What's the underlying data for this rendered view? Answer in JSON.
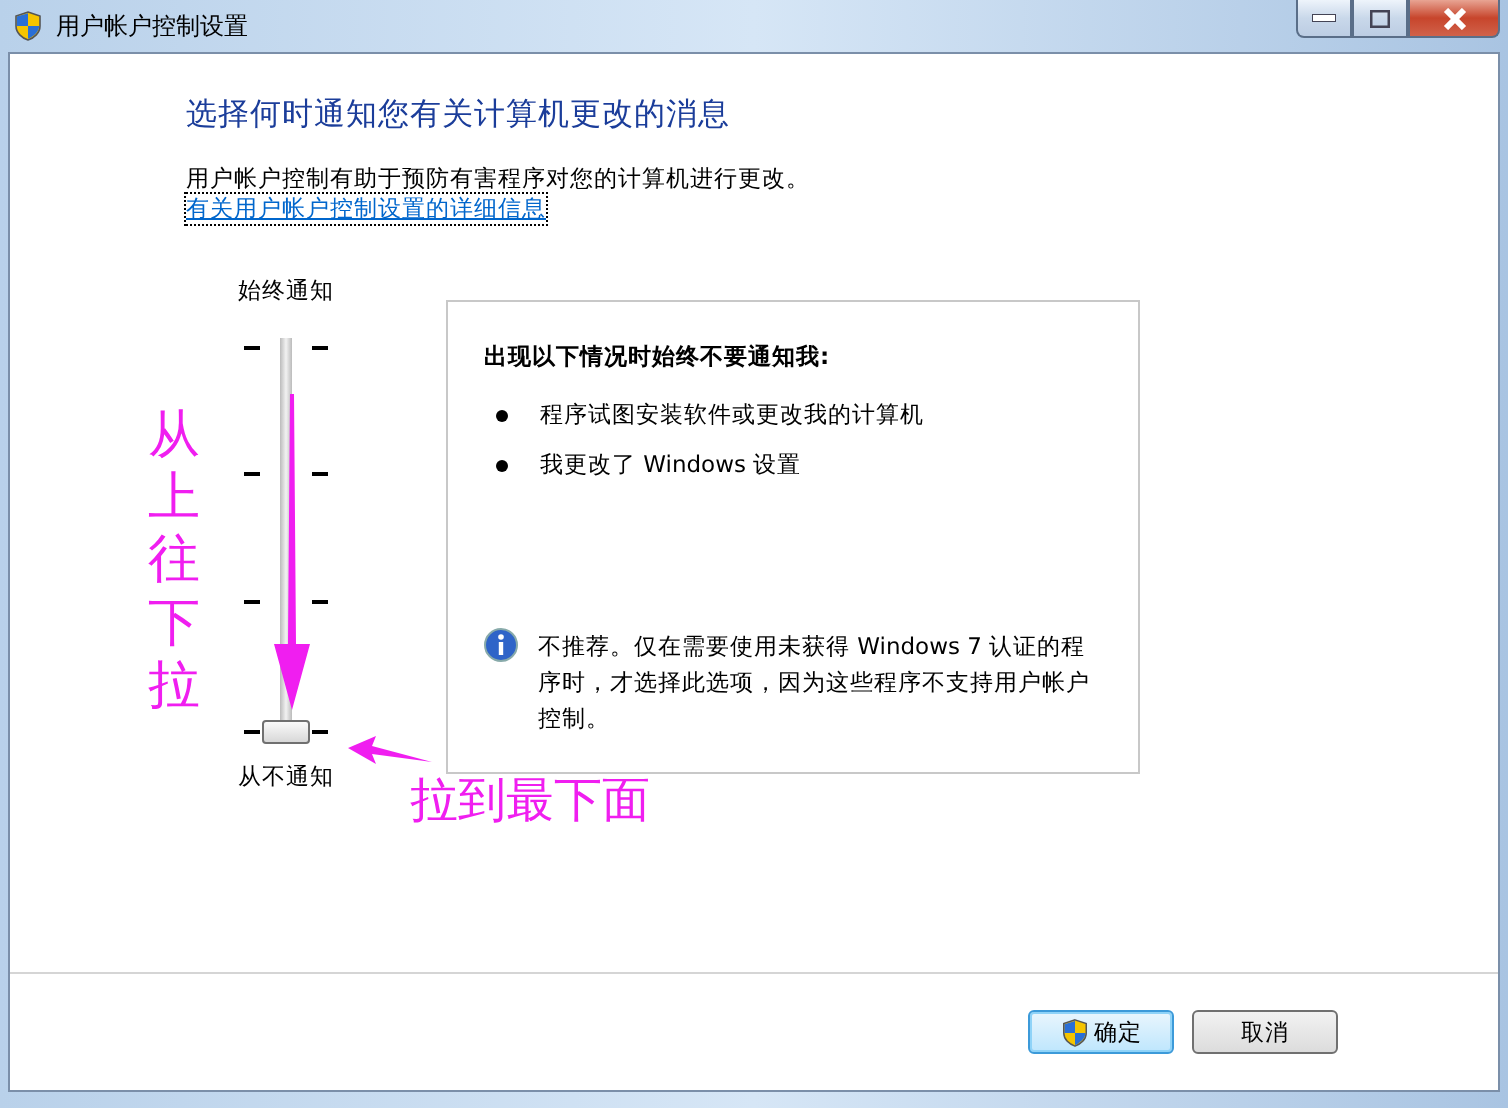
{
  "window": {
    "title": "用户帐户控制设置"
  },
  "heading": "选择何时通知您有关计算机更改的消息",
  "description": "用户帐户控制有助于预防有害程序对您的计算机进行更改。",
  "link": "有关用户帐户控制设置的详细信息",
  "slider": {
    "top_label": "始终通知",
    "bottom_label": "从不通知",
    "level": 0
  },
  "panel": {
    "title": "出现以下情况时始终不要通知我:",
    "bullets": [
      "程序试图安装软件或更改我的计算机",
      "我更改了 Windows 设置"
    ],
    "note": "不推荐。仅在需要使用未获得 Windows 7 认证的程序时，才选择此选项，因为这些程序不支持用户帐户控制。"
  },
  "annotations": {
    "vertical": "从上往下拉",
    "horizontal": "拉到最下面"
  },
  "buttons": [
    {
      "label": "确定",
      "kind": "shield",
      "default": true
    },
    {
      "label": "取消",
      "kind": "plain",
      "default": false
    }
  ]
}
